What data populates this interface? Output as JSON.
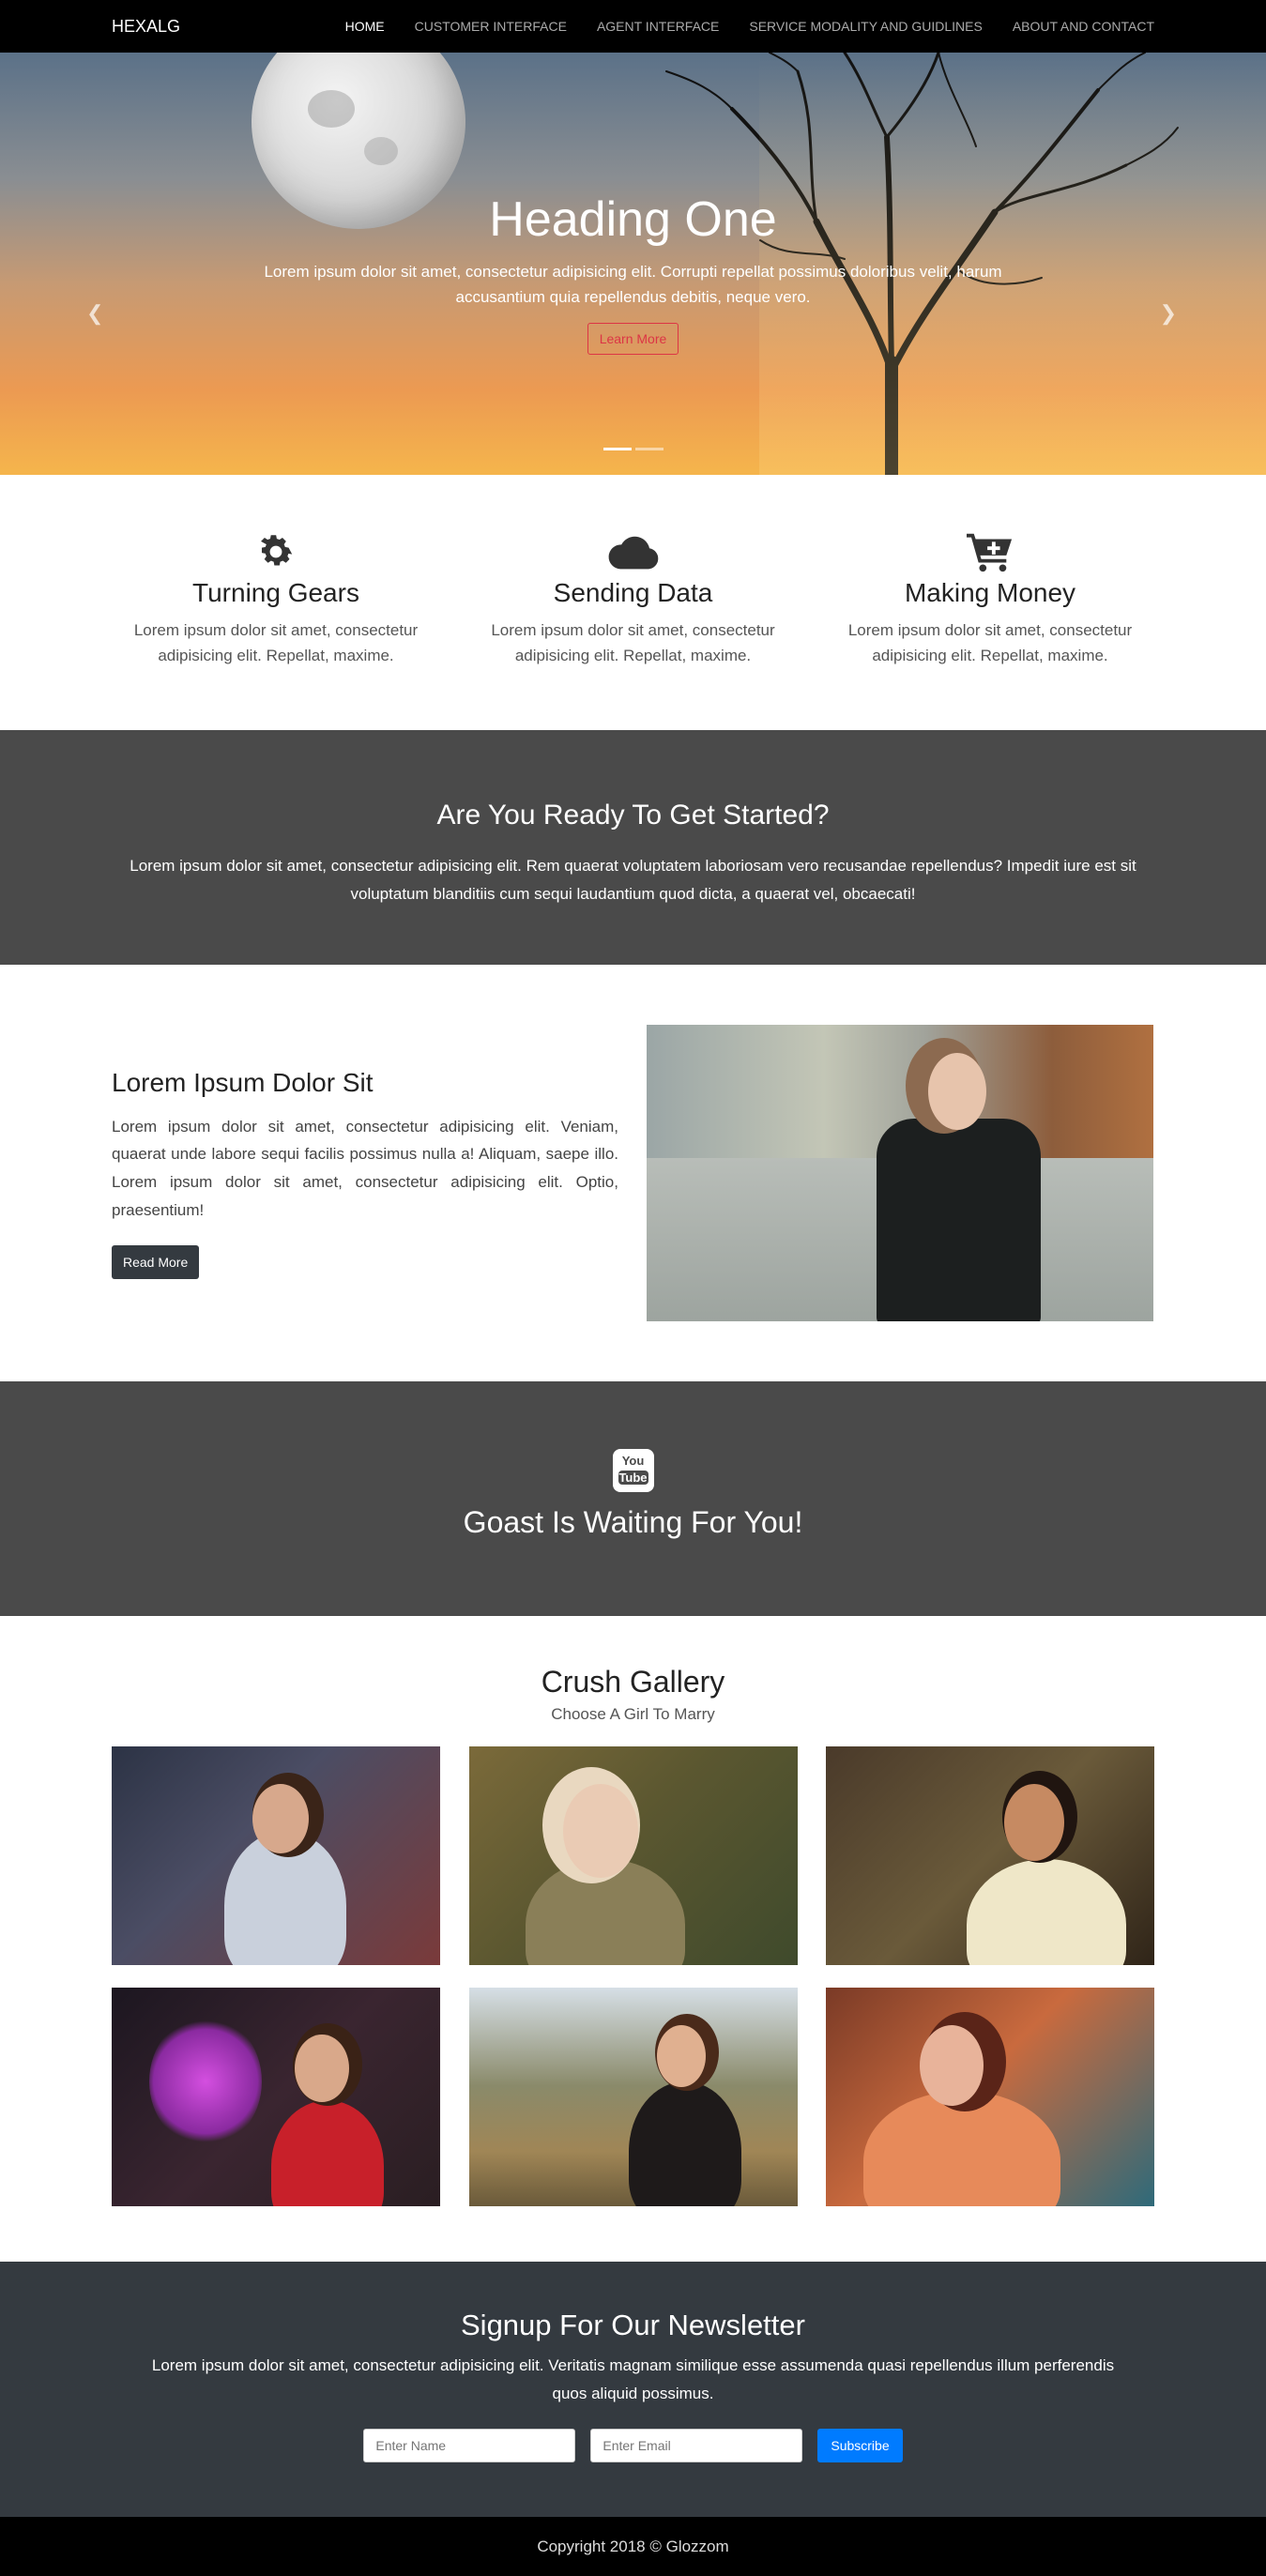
{
  "nav": {
    "brand": "HEXALG",
    "items": [
      {
        "label": "HOME",
        "active": true
      },
      {
        "label": "CUSTOMER INTERFACE",
        "active": false
      },
      {
        "label": "AGENT INTERFACE",
        "active": false
      },
      {
        "label": "SERVICE MODALITY AND GUIDLINES",
        "active": false
      },
      {
        "label": "ABOUT AND CONTACT",
        "active": false
      }
    ]
  },
  "hero": {
    "heading": "Heading One",
    "text": "Lorem ipsum dolor sit amet, consectetur adipisicing elit. Corrupti repellat possimus doloribus velit, harum accusantium quia repellendus debitis, neque vero.",
    "button": "Learn More",
    "slides": 2,
    "active_slide": 1
  },
  "features": [
    {
      "icon": "gear-icon",
      "title": "Turning Gears",
      "text": "Lorem ipsum dolor sit amet, consectetur adipisicing elit. Repellat, maxime."
    },
    {
      "icon": "cloud-icon",
      "title": "Sending Data",
      "text": "Lorem ipsum dolor sit amet, consectetur adipisicing elit. Repellat, maxime."
    },
    {
      "icon": "cart-plus-icon",
      "title": "Making Money",
      "text": "Lorem ipsum dolor sit amet, consectetur adipisicing elit. Repellat, maxime."
    }
  ],
  "started": {
    "title": "Are You Ready To Get Started?",
    "text": "Lorem ipsum dolor sit amet, consectetur adipisicing elit. Rem quaerat voluptatem laboriosam vero recusandae repellendus? Impedit iure est sit voluptatum blanditiis cum sequi laudantium quod dicta, a quaerat vel, obcaecati!"
  },
  "info": {
    "title": "Lorem Ipsum Dolor Sit",
    "text": "Lorem ipsum dolor sit amet, consectetur adipisicing elit. Veniam, quaerat unde labore sequi facilis possimus nulla a! Aliquam, saepe illo. Lorem ipsum dolor sit amet, consectetur adipisicing elit. Optio, praesentium!",
    "button": "Read More"
  },
  "video": {
    "icon": "youtube-icon",
    "icon_top": "You",
    "icon_bottom": "Tube",
    "title": "Goast Is Waiting For You!"
  },
  "gallery": {
    "title": "Crush Gallery",
    "subtitle": "Choose A Girl To Marry"
  },
  "newsletter": {
    "title": "Signup For Our Newsletter",
    "text": "Lorem ipsum dolor sit amet, consectetur adipisicing elit. Veritatis magnam similique esse assumenda quasi repellendus illum perferendis quos aliquid possimus.",
    "name_placeholder": "Enter Name",
    "email_placeholder": "Enter Email",
    "button": "Subscribe"
  },
  "footer": {
    "copyright": "Copyright 2018 © Glozzom"
  },
  "colors": {
    "nav_bg": "#000000",
    "band_bg": "#4a4a4a",
    "newsletter_bg": "#343a40",
    "primary": "#007bff",
    "danger": "#dc3545"
  }
}
